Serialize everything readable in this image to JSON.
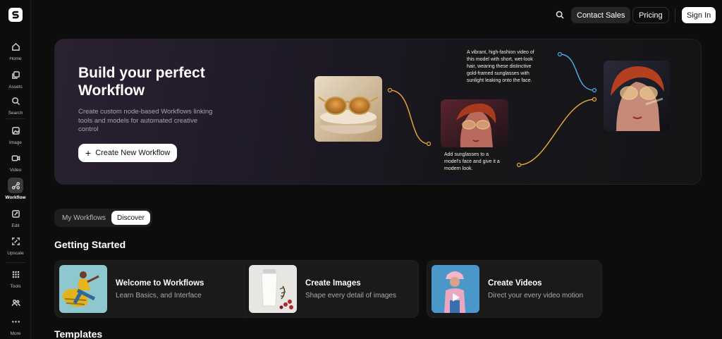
{
  "sidebar": {
    "items": [
      {
        "label": "Home",
        "icon": "home-icon"
      },
      {
        "label": "Assets",
        "icon": "assets-icon"
      },
      {
        "label": "Search",
        "icon": "search-icon"
      },
      {
        "label": "Image",
        "icon": "image-icon"
      },
      {
        "label": "Video",
        "icon": "video-icon"
      },
      {
        "label": "Workflow",
        "icon": "workflow-icon"
      },
      {
        "label": "Edit",
        "icon": "edit-icon"
      },
      {
        "label": "Upscale",
        "icon": "upscale-icon"
      },
      {
        "label": "Tools",
        "icon": "grid-icon"
      },
      {
        "label": "",
        "icon": "people-icon"
      },
      {
        "label": "More",
        "icon": "more-dots-icon"
      }
    ]
  },
  "topbar": {
    "contact_label": "Contact Sales",
    "pricing_label": "Pricing",
    "signin_label": "Sign In"
  },
  "hero": {
    "title": "Build your perfect Workflow",
    "subtitle": "Create custom node-based Workflows linking tools and models for automated creative control",
    "cta_label": "Create New Workflow",
    "note_top": "A vibrant, high-fashion video of this model with short, wet-look hair, wearing these distinctive gold-framed sunglasses with sunlight leaking onto the face.",
    "note_bottom": "Add sunglasses to a model's face and give it a modern look."
  },
  "tabs": {
    "my_workflows": "My Workflows",
    "discover": "Discover"
  },
  "getting_started": {
    "title": "Getting Started",
    "cards": [
      {
        "title": "Welcome to Workflows",
        "subtitle": "Learn Basics, and Interface"
      },
      {
        "title": "Create Images",
        "subtitle": "Shape every detail of images"
      },
      {
        "title": "Create Videos",
        "subtitle": "Direct your every video motion"
      }
    ]
  },
  "templates": {
    "title": "Templates"
  },
  "colors": {
    "background": "#0d0d0d",
    "accent_orange_wire": "#e3a43c",
    "accent_blue_wire": "#4aa8e8"
  }
}
